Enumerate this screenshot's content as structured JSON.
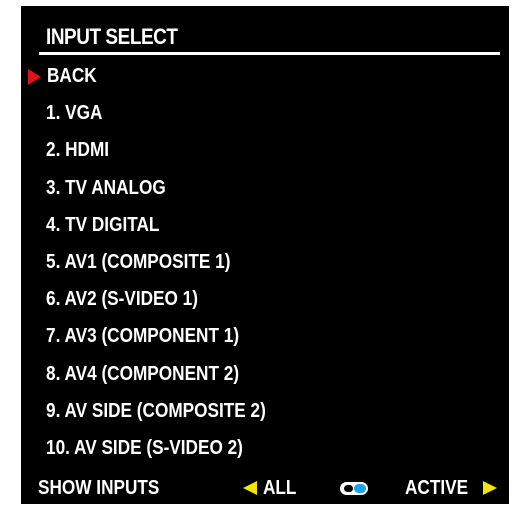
{
  "menu": {
    "title": "INPUT SELECT",
    "items": [
      {
        "label": "BACK",
        "selected": true
      },
      {
        "label": "1. VGA",
        "selected": false
      },
      {
        "label": "2. HDMI",
        "selected": false
      },
      {
        "label": "3. TV ANALOG",
        "selected": false
      },
      {
        "label": "4. TV DIGITAL",
        "selected": false
      },
      {
        "label": "5. AV1 (COMPOSITE 1)",
        "selected": false
      },
      {
        "label": "6. AV2 (S-VIDEO 1)",
        "selected": false
      },
      {
        "label": "7. AV3 (COMPONENT 1)",
        "selected": false
      },
      {
        "label": "8. AV4 (COMPONENT 2)",
        "selected": false
      },
      {
        "label": "9. AV SIDE (COMPOSITE 2)",
        "selected": false
      },
      {
        "label": "10. AV SIDE (S-VIDEO 2)",
        "selected": false
      }
    ]
  },
  "footer": {
    "show_inputs_label": "SHOW INPUTS",
    "all_label": "ALL",
    "active_label": "ACTIVE",
    "toggle_state": "active"
  },
  "colors": {
    "background": "#000000",
    "text": "#ffffff",
    "cursor": "#e0131a",
    "arrows": "#f2e600",
    "toggle_knob": "#1aa3ea"
  },
  "icons": {
    "cursor": "red-triangle-right-icon",
    "left_arrow": "yellow-triangle-left-icon",
    "right_arrow": "yellow-triangle-right-icon",
    "toggle": "toggle-switch-icon"
  }
}
